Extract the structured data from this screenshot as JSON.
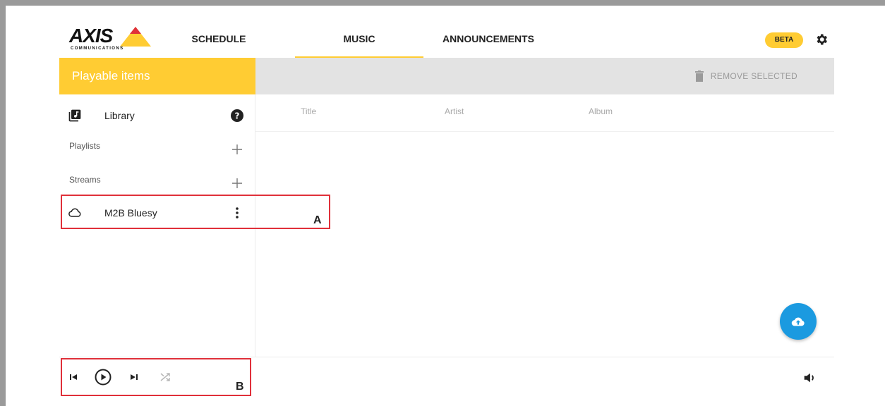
{
  "logo": {
    "name": "AXIS",
    "sub": "COMMUNICATIONS"
  },
  "nav": {
    "tabs": [
      {
        "label": "SCHEDULE",
        "active": false
      },
      {
        "label": "MUSIC",
        "active": true
      },
      {
        "label": "ANNOUNCEMENTS",
        "active": false
      }
    ],
    "badge": "BETA"
  },
  "sidebar": {
    "title": "Playable items",
    "library_label": "Library",
    "playlists_label": "Playlists",
    "streams_label": "Streams",
    "stream_item": "M2B Bluesy"
  },
  "main": {
    "remove_label": "REMOVE SELECTED",
    "columns": [
      "Title",
      "Artist",
      "Album"
    ]
  },
  "annotations": {
    "a": "A",
    "b": "B"
  },
  "colors": {
    "accent": "#ffcc33",
    "fab": "#1b9ae0",
    "annotation": "#e0303a"
  }
}
